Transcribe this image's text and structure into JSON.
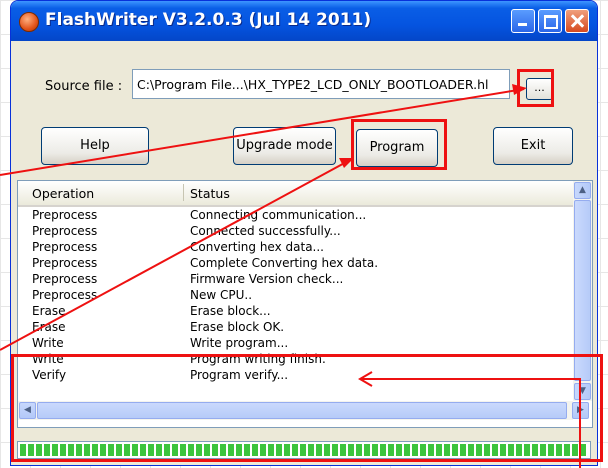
{
  "window": {
    "title": "FlashWriter V3.2.0.3 (Jul 14 2011)"
  },
  "source": {
    "label": "Source file :",
    "path": "C:\\Program File...\\HX_TYPE2_LCD_ONLY_BOOTLOADER.hl",
    "browse_label": "..."
  },
  "buttons": {
    "help": "Help",
    "upgrade": "Upgrade mode",
    "program": "Program",
    "exit": "Exit"
  },
  "log": {
    "headers": [
      "Operation",
      "Status"
    ],
    "rows": [
      [
        "Preprocess",
        "Connecting communication..."
      ],
      [
        "Preprocess",
        "Connected successfully..."
      ],
      [
        "Preprocess",
        "Converting hex data..."
      ],
      [
        "Preprocess",
        "Complete Converting hex data."
      ],
      [
        "Preprocess",
        "Firmware Version check..."
      ],
      [
        "Preprocess",
        "New CPU.."
      ],
      [
        "Erase",
        "Erase block..."
      ],
      [
        "Erase",
        "Erase block OK."
      ],
      [
        "Write",
        "Write program..."
      ],
      [
        "Write",
        "Program writing finish."
      ],
      [
        "Verify",
        "Program verify..."
      ]
    ]
  },
  "progress": {
    "percent": 100
  },
  "colors": {
    "annotation": "#ee1111",
    "titlebar": "#0554e0",
    "progress": "#3cc43c"
  },
  "icons": {
    "app": "flashwriter-app-icon",
    "minimize": "minimize-icon",
    "maximize": "maximize-icon",
    "close": "close-icon"
  }
}
